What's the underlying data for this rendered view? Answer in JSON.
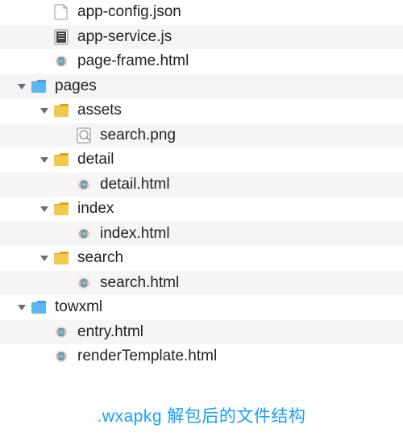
{
  "tree": {
    "rows": [
      {
        "indent": 1,
        "arrow": false,
        "icon": "file-json",
        "label": "app-config.json",
        "shaded": false
      },
      {
        "indent": 1,
        "arrow": false,
        "icon": "file-js",
        "label": "app-service.js",
        "shaded": true
      },
      {
        "indent": 1,
        "arrow": false,
        "icon": "file-html",
        "label": "page-frame.html",
        "shaded": false
      },
      {
        "indent": 0,
        "arrow": true,
        "icon": "folder-blue",
        "label": "pages",
        "shaded": true
      },
      {
        "indent": 1,
        "arrow": true,
        "icon": "folder-yellow",
        "label": "assets",
        "shaded": false
      },
      {
        "indent": 2,
        "arrow": false,
        "icon": "file-png",
        "label": "search.png",
        "shaded": true
      },
      {
        "indent": 1,
        "arrow": true,
        "icon": "folder-yellow",
        "label": "detail",
        "shaded": false
      },
      {
        "indent": 2,
        "arrow": false,
        "icon": "file-html",
        "label": "detail.html",
        "shaded": true
      },
      {
        "indent": 1,
        "arrow": true,
        "icon": "folder-yellow",
        "label": "index",
        "shaded": false
      },
      {
        "indent": 2,
        "arrow": false,
        "icon": "file-html",
        "label": "index.html",
        "shaded": true
      },
      {
        "indent": 1,
        "arrow": true,
        "icon": "folder-yellow",
        "label": "search",
        "shaded": false
      },
      {
        "indent": 2,
        "arrow": false,
        "icon": "file-html",
        "label": "search.html",
        "shaded": true
      },
      {
        "indent": 0,
        "arrow": true,
        "icon": "folder-blue",
        "label": "towxml",
        "shaded": false
      },
      {
        "indent": 1,
        "arrow": false,
        "icon": "file-html",
        "label": "entry.html",
        "shaded": true
      },
      {
        "indent": 1,
        "arrow": false,
        "icon": "file-html",
        "label": "renderTemplate.html",
        "shaded": false
      }
    ]
  },
  "caption": ".wxapkg 解包后的文件结构"
}
